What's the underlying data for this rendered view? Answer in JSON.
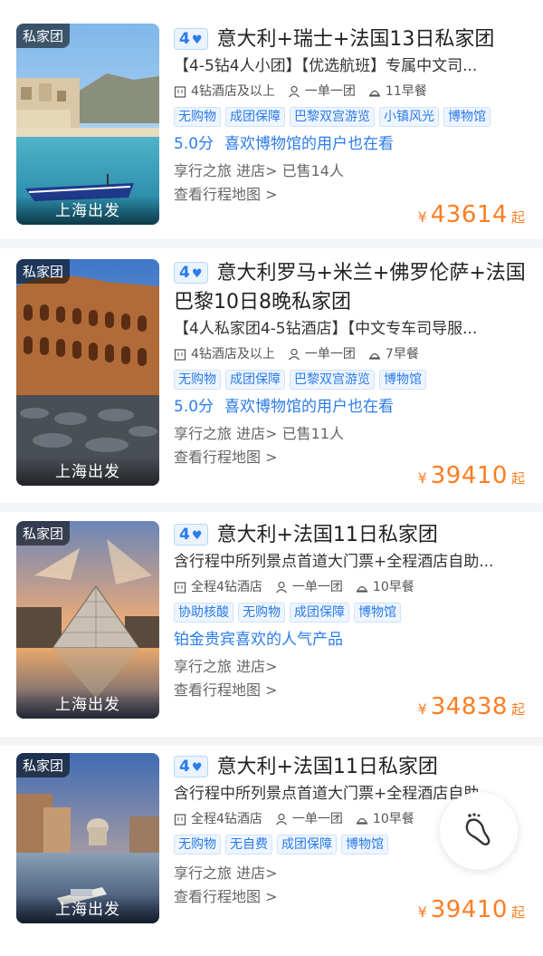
{
  "colors": {
    "accent": "#2b7bea",
    "price": "#ff7d22",
    "tag_bg": "#eef5ff"
  },
  "cards": [
    {
      "badge": "私家团",
      "depart": "上海出发",
      "score": "4",
      "title": "意大利+瑞士+法国13日私家团",
      "subtitle": "【4-5钻4人小团】【优选航班】专属中文司...",
      "features": [
        {
          "icon": "hotel-icon",
          "label": "4钻酒店及以上"
        },
        {
          "icon": "person-icon",
          "label": "一单一团"
        },
        {
          "icon": "breakfast-icon",
          "label": "11早餐"
        }
      ],
      "tags": [
        "无购物",
        "成团保障",
        "巴黎双宫游览",
        "小镇风光",
        "博物馆"
      ],
      "highlight_score": "5.0分",
      "highlight_text": "喜欢博物馆的用户也在看",
      "meta": "享行之旅 进店> 已售14人",
      "map": "查看行程地图 >",
      "yen": "¥",
      "price": "43614",
      "qi": "起"
    },
    {
      "badge": "私家团",
      "depart": "上海出发",
      "score": "4",
      "title": "意大利罗马+米兰+佛罗伦萨+法国巴黎10日8晚私家团",
      "subtitle": "【4人私家团4-5钻酒店】【中文专车司导服...",
      "features": [
        {
          "icon": "hotel-icon",
          "label": "4钻酒店及以上"
        },
        {
          "icon": "person-icon",
          "label": "一单一团"
        },
        {
          "icon": "breakfast-icon",
          "label": "7早餐"
        }
      ],
      "tags": [
        "无购物",
        "成团保障",
        "巴黎双宫游览",
        "博物馆"
      ],
      "highlight_score": "5.0分",
      "highlight_text": "喜欢博物馆的用户也在看",
      "meta": "享行之旅 进店> 已售11人",
      "map": "查看行程地图 >",
      "yen": "¥",
      "price": "39410",
      "qi": "起"
    },
    {
      "badge": "私家团",
      "depart": "上海出发",
      "score": "4",
      "title": "意大利+法国11日私家团",
      "subtitle": "含行程中所列景点首道大门票+全程酒店自助...",
      "features": [
        {
          "icon": "hotel-icon",
          "label": "全程4钻酒店"
        },
        {
          "icon": "person-icon",
          "label": "一单一团"
        },
        {
          "icon": "breakfast-icon",
          "label": "10早餐"
        }
      ],
      "tags": [
        "协助核酸",
        "无购物",
        "成团保障",
        "博物馆"
      ],
      "highlight_score": "",
      "highlight_text": "铂金贵宾喜欢的人气产品",
      "meta": "享行之旅 进店>",
      "map": "查看行程地图 >",
      "yen": "¥",
      "price": "34838",
      "qi": "起"
    },
    {
      "badge": "私家团",
      "depart": "上海出发",
      "score": "4",
      "title": "意大利+法国11日私家团",
      "subtitle": "含行程中所列景点首道大门票+全程酒店自助...",
      "features": [
        {
          "icon": "hotel-icon",
          "label": "全程4钻酒店"
        },
        {
          "icon": "person-icon",
          "label": "一单一团"
        },
        {
          "icon": "breakfast-icon",
          "label": "10早餐"
        }
      ],
      "tags": [
        "无购物",
        "无自费",
        "成团保障",
        "博物馆"
      ],
      "highlight_score": "",
      "highlight_text": "",
      "meta": "享行之旅 进店>",
      "map": "查看行程地图 >",
      "yen": "¥",
      "price": "39410",
      "qi": "起"
    }
  ],
  "float_button": {
    "icon": "footprint-icon"
  }
}
